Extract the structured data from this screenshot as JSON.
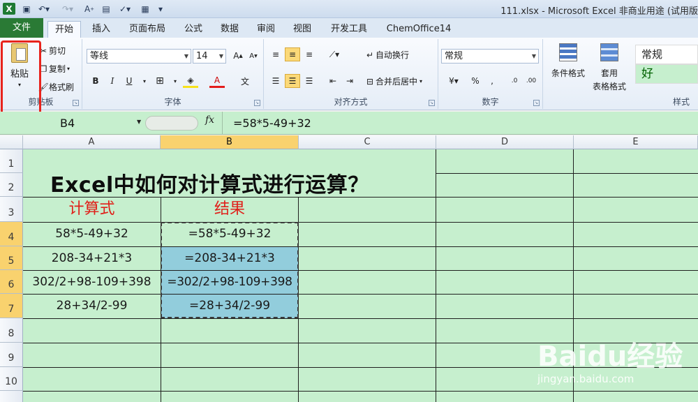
{
  "window": {
    "title": "111.xlsx - Microsoft Excel 非商业用途 (试用版"
  },
  "tabs": [
    "文件",
    "开始",
    "插入",
    "页面布局",
    "公式",
    "数据",
    "审阅",
    "视图",
    "开发工具",
    "ChemOffice14"
  ],
  "clipboard": {
    "paste": "粘贴",
    "cut": "剪切",
    "copy": "复制",
    "format_painter": "格式刷",
    "group": "剪贴板"
  },
  "font": {
    "name": "等线",
    "size": "14",
    "group": "字体"
  },
  "alignment": {
    "wrap": "自动换行",
    "merge": "合并后居中",
    "group": "对齐方式"
  },
  "number": {
    "format": "常规",
    "group": "数字"
  },
  "styles": {
    "cond_format": "条件格式",
    "table_format_1": "套用",
    "table_format_2": "表格格式",
    "style_normal": "常规",
    "style_good": "好",
    "group": "样式"
  },
  "formula_bar": {
    "name_box": "B4",
    "fx": "fx",
    "formula": "=58*5-49+32"
  },
  "columns": [
    "A",
    "B",
    "C",
    "D",
    "E"
  ],
  "rows": [
    "1",
    "2",
    "3",
    "4",
    "5",
    "6",
    "7",
    "8",
    "9",
    "10"
  ],
  "sheet": {
    "title": "Excel中如何对计算式进行运算？",
    "header_a": "计算式",
    "header_b": "结果",
    "data": [
      {
        "a": "58*5-49+32",
        "b": "=58*5-49+32"
      },
      {
        "a": "208-34+21*3",
        "b": "=208-34+21*3"
      },
      {
        "a": "302/2+98-109+398",
        "b": "=302/2+98-109+398"
      },
      {
        "a": "28+34/2-99",
        "b": "=28+34/2-99"
      }
    ]
  },
  "watermark": {
    "brand": "Baidu经验",
    "url": "jingyan.baidu.com"
  },
  "colors": {
    "sheet_bg": "#c6efce",
    "highlight": "#92cddc",
    "header_red": "#e0201a",
    "file_tab": "#2a7a35",
    "selected_header": "#f9d26e"
  }
}
